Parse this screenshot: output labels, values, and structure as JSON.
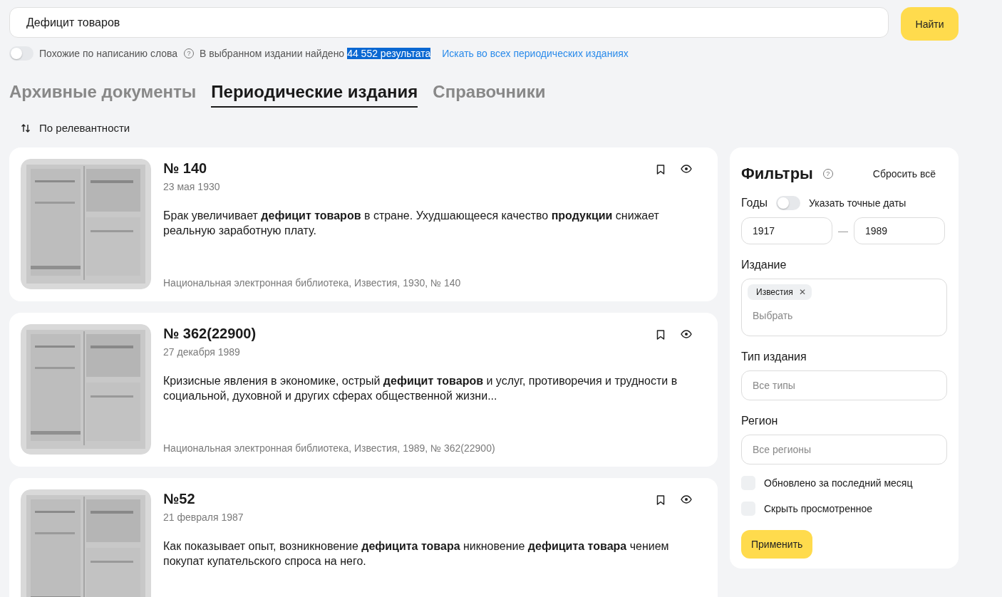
{
  "search": {
    "value": "Дефицит товаров",
    "button": "Найти"
  },
  "options": {
    "similar_spelling": {
      "label": "Похожие по написанию слова",
      "on": false,
      "help": "?"
    },
    "found_text": "В выбранном издании найдено",
    "found_count": {
      "text": "44 552 результата",
      "selected": true
    },
    "search_all_link": "Искать во всех периодических изданиях"
  },
  "tabs": [
    {
      "label": "Архивные документы",
      "selected": false
    },
    {
      "label": "Периодические издания",
      "selected": true
    },
    {
      "label": "Справочники",
      "selected": false
    }
  ],
  "sort": {
    "label": "По релевантности"
  },
  "results": [
    {
      "title": "№ 140",
      "date": "23 мая 1930",
      "snippet": "Брак увеличивает **дефицит товаров** в стране. Ухудшающееся качество **продукции** снижает реальную заработную плату.",
      "source": "Национальная электронная библиотека, Известия, 1930, № 140"
    },
    {
      "title": "№ 362(22900)",
      "date": "27 декабря 1989",
      "snippet": "Кризисные явления в экономике, острый **дефицит товаров** и услуг, противоречия и трудности в социальной, духовной и других сферах общественной жизни...",
      "source": "Национальная электронная библиотека, Известия, 1989, № 362(22900)"
    },
    {
      "title": "№52",
      "date": "21 февраля 1987",
      "snippet": "Как показывает опыт, возникновение **дефицита товара** никновение **дефицита товара** чением покупат купательского спроса на него."
    }
  ],
  "filters": {
    "title": "Фильтры",
    "help": "?",
    "reset": "Сбросить всё",
    "years": {
      "label": "Годы",
      "exact_dates": {
        "label": "Указать точные даты",
        "on": false
      },
      "from": "1917",
      "separator": "—",
      "to": "1989"
    },
    "edition": {
      "label": "Издание",
      "chips": [
        {
          "label": "Известия",
          "remove": "✕"
        }
      ],
      "placeholder": "Выбрать"
    },
    "edition_type": {
      "label": "Тип издания",
      "placeholder": "Все типы"
    },
    "region": {
      "label": "Регион",
      "placeholder": "Все регионы"
    },
    "checkboxes": [
      {
        "label": "Обновлено за последний месяц",
        "checked": false
      },
      {
        "label": "Скрыть просмотренное",
        "checked": false
      }
    ],
    "apply": "Применить"
  }
}
